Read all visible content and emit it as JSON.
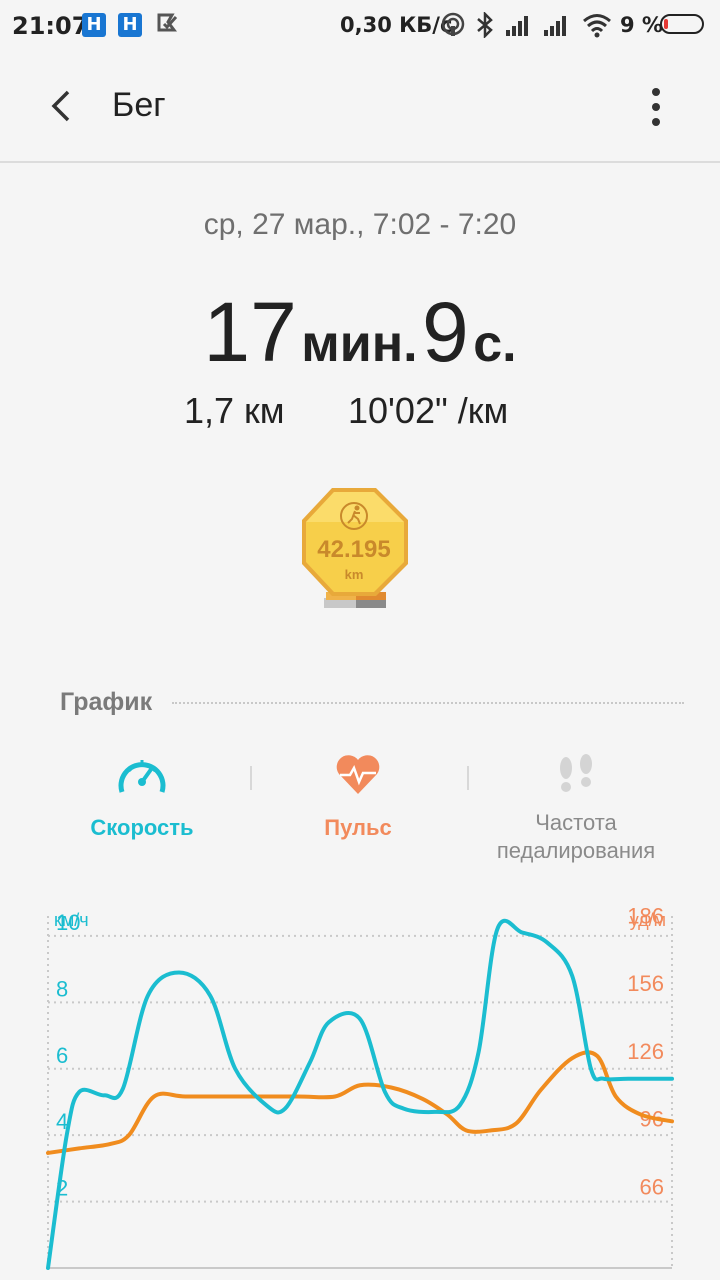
{
  "status_bar": {
    "time": "21:07",
    "notif_1": "H",
    "notif_2": "H",
    "net_speed": "0,30 КБ/с",
    "battery": "9 %",
    "battery_color": "#e53935"
  },
  "header": {
    "title": "Бег",
    "back_icon": "chevron-left-icon",
    "more_icon": "more-vertical-icon"
  },
  "summary": {
    "date": "ср, 27 мар., 7:02 - 7:20",
    "duration_minutes": "17",
    "duration_minutes_unit": "мин.",
    "duration_seconds": "9",
    "duration_seconds_unit": "с.",
    "distance": "1,7 км",
    "pace": "10'02\" /км"
  },
  "medal": {
    "value": "42.195",
    "unit": "km",
    "color": "#f5c73d"
  },
  "graph_section": {
    "title": "График",
    "tabs": [
      {
        "label": "Скорость",
        "icon": "speedometer-icon",
        "color": "#1bbdd0"
      },
      {
        "label": "Пульс",
        "icon": "heart-pulse-icon",
        "color": "#f28a5c"
      },
      {
        "label_line1": "Частота",
        "label_line2": "педалирования",
        "icon": "footprints-icon",
        "color": "#8a8a8a"
      }
    ]
  },
  "chart_data": {
    "type": "line",
    "left_axis": {
      "unit": "км/ч",
      "ticks": [
        "10",
        "8",
        "6",
        "4",
        "2"
      ],
      "range": [
        0,
        10.6
      ],
      "color": "#1bbdd0"
    },
    "right_axis": {
      "unit": "уд/м",
      "ticks": [
        "186",
        "156",
        "126",
        "96",
        "66"
      ],
      "range": [
        36,
        192
      ],
      "color": "#f28a5c"
    },
    "x_range": [
      0,
      100
    ],
    "series": [
      {
        "axis": "left",
        "color": "#1bbdd0",
        "points": [
          [
            0,
            0
          ],
          [
            3,
            4
          ],
          [
            5,
            5.3
          ],
          [
            9,
            5.2
          ],
          [
            12,
            5.4
          ],
          [
            16,
            8.2
          ],
          [
            21,
            8.9
          ],
          [
            26,
            8.2
          ],
          [
            30,
            6.0
          ],
          [
            35,
            4.9
          ],
          [
            38,
            4.8
          ],
          [
            42,
            6.2
          ],
          [
            45,
            7.4
          ],
          [
            50,
            7.5
          ],
          [
            54,
            5.3
          ],
          [
            57,
            4.8
          ],
          [
            62,
            4.7
          ],
          [
            66,
            4.9
          ],
          [
            69,
            6.5
          ],
          [
            72,
            10.2
          ],
          [
            76,
            10.1
          ],
          [
            80,
            9.8
          ],
          [
            84,
            8.8
          ],
          [
            87,
            6.0
          ],
          [
            89,
            5.7
          ],
          [
            93,
            5.7
          ],
          [
            100,
            5.7
          ]
        ]
      },
      {
        "axis": "right",
        "color": "#f08c1e",
        "points": [
          [
            0,
            87
          ],
          [
            5,
            89
          ],
          [
            10,
            91
          ],
          [
            13,
            95
          ],
          [
            17,
            112
          ],
          [
            22,
            112
          ],
          [
            30,
            112
          ],
          [
            40,
            112
          ],
          [
            46,
            112
          ],
          [
            50,
            117
          ],
          [
            55,
            116
          ],
          [
            60,
            111
          ],
          [
            64,
            104
          ],
          [
            67,
            97
          ],
          [
            71,
            97
          ],
          [
            75,
            100
          ],
          [
            79,
            115
          ],
          [
            84,
            129
          ],
          [
            88,
            130
          ],
          [
            91,
            112
          ],
          [
            95,
            104
          ],
          [
            100,
            101
          ]
        ]
      }
    ]
  }
}
